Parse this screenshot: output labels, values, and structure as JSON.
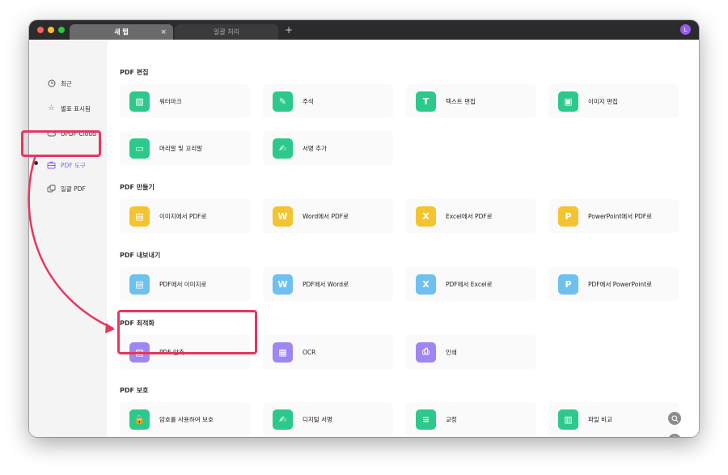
{
  "window": {
    "tabs": [
      {
        "label": "새 탭"
      },
      {
        "label": "일괄 처리"
      }
    ],
    "tab_close": "×",
    "add_tab": "+",
    "avatar_initial": "L"
  },
  "sidebar": {
    "items": [
      {
        "label": "최근",
        "icon": "clock-icon"
      },
      {
        "label": "별표 표시됨",
        "icon": "star-icon"
      },
      {
        "label": "UPDF Cloud",
        "icon": "cloud-icon"
      },
      {
        "label": "PDF 도구",
        "icon": "toolbox-icon",
        "active": true
      },
      {
        "label": "일괄 PDF",
        "icon": "batch-icon"
      }
    ]
  },
  "sections": [
    {
      "title": "PDF 편집",
      "tools": [
        {
          "label": "워터마크",
          "color": "#2cc98b"
        },
        {
          "label": "주석",
          "color": "#2cc98b"
        },
        {
          "label": "텍스트 편집",
          "color": "#2cc98b"
        },
        {
          "label": "이미지 편집",
          "color": "#2cc98b"
        },
        {
          "label": "머리말 및 꼬리말",
          "color": "#2cc98b"
        },
        {
          "label": "서명 추가",
          "color": "#2cc98b"
        }
      ]
    },
    {
      "title": "PDF 만들기",
      "tools": [
        {
          "label": "이미지에서 PDF로",
          "color": "#f4c430"
        },
        {
          "label": "Word에서 PDF로",
          "color": "#f4c430"
        },
        {
          "label": "Excel에서 PDF로",
          "color": "#f4c430"
        },
        {
          "label": "PowerPoint에서 PDF로",
          "color": "#f4c430"
        }
      ]
    },
    {
      "title": "PDF 내보내기",
      "tools": [
        {
          "label": "PDF에서 이미지로",
          "color": "#6ec1ef"
        },
        {
          "label": "PDF에서 Word로",
          "color": "#6ec1ef"
        },
        {
          "label": "PDF에서 Excel로",
          "color": "#6ec1ef"
        },
        {
          "label": "PDF에서 PowerPoint로",
          "color": "#6ec1ef"
        }
      ]
    },
    {
      "title": "PDF 최적화",
      "tools": [
        {
          "label": "PDF 압축",
          "color": "#9f86f0"
        },
        {
          "label": "OCR",
          "color": "#9f86f0"
        },
        {
          "label": "인쇄",
          "color": "#9f86f0"
        }
      ]
    },
    {
      "title": "PDF 보호",
      "tools": [
        {
          "label": "암호를 사용하여 보호",
          "color": "#2cc98b"
        },
        {
          "label": "디지털 서명",
          "color": "#2cc98b"
        },
        {
          "label": "교정",
          "color": "#2cc98b"
        },
        {
          "label": "파일 비교",
          "color": "#2cc98b"
        }
      ]
    }
  ],
  "floating": {
    "help": "?"
  },
  "accent_color": "#8b5cf6",
  "highlight_color": "#e8365d"
}
